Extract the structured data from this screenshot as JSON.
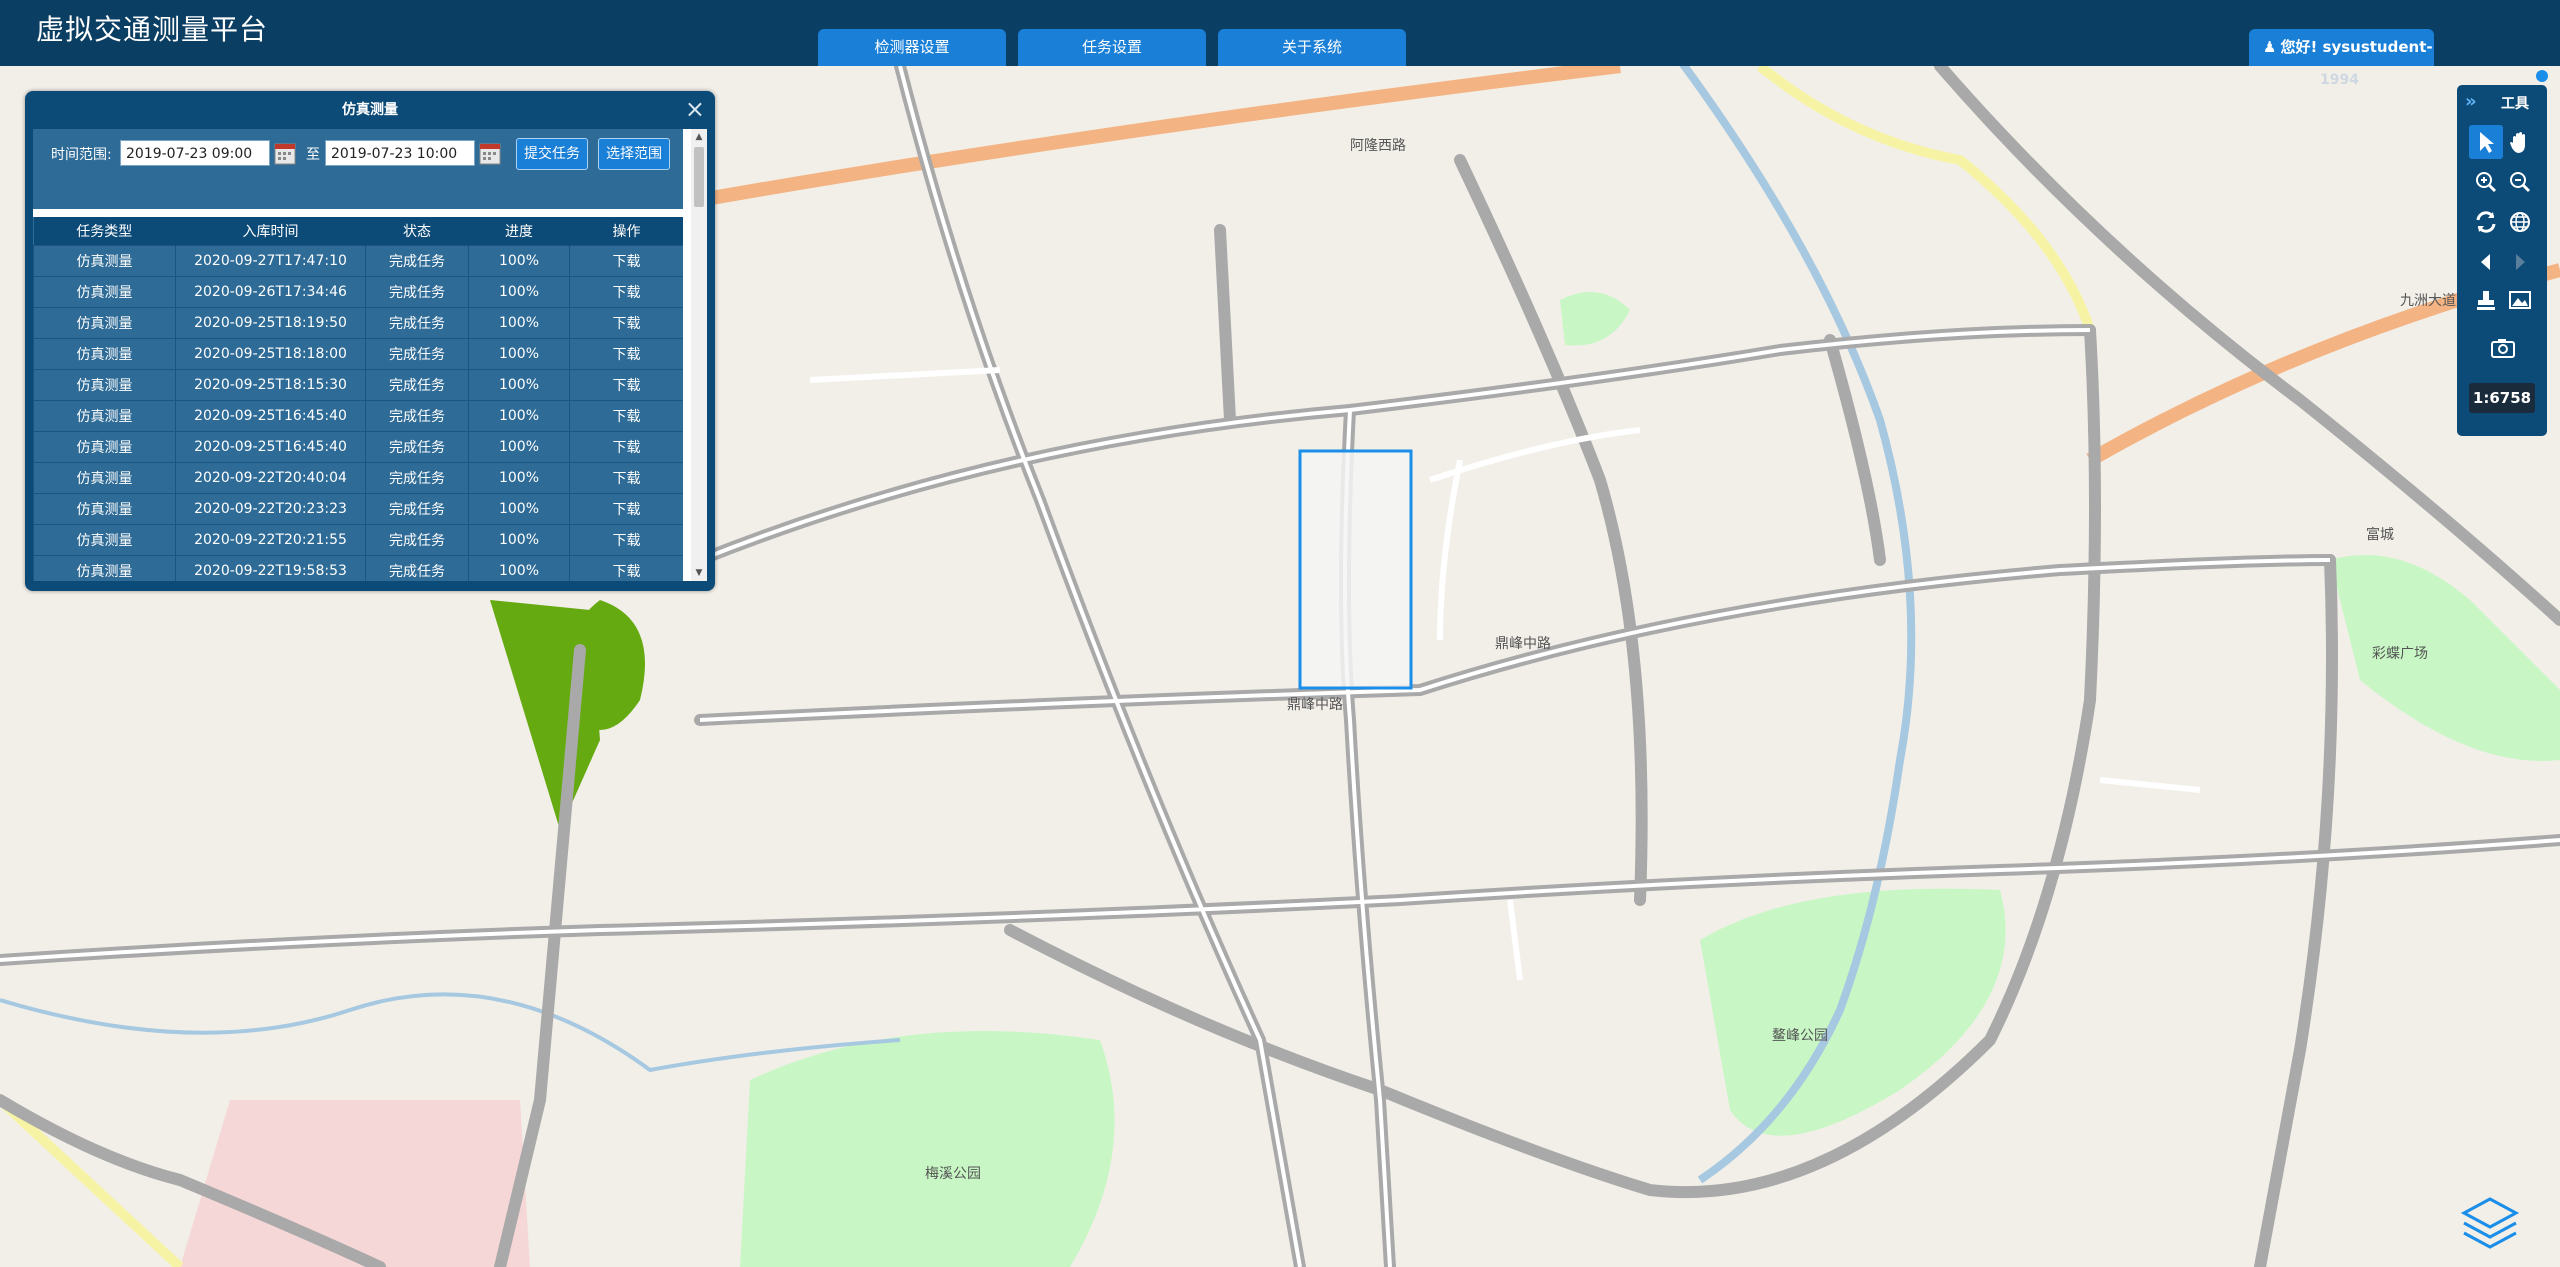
{
  "app": {
    "title": "虚拟交通测量平台"
  },
  "nav": [
    {
      "label": "检测器设置"
    },
    {
      "label": "任务设置"
    },
    {
      "label": "关于系统"
    }
  ],
  "user": {
    "greeting": "您好! sysustudent-",
    "overflow": "1994"
  },
  "panel": {
    "title": "仿真测量",
    "close": "×",
    "time_range_label": "时间范围:",
    "start_time": "2019-07-23 09:00",
    "to_label": "至",
    "end_time": "2019-07-23 10:00",
    "submit_label": "提交任务",
    "select_range_label": "选择范围",
    "table": {
      "headers": [
        "任务类型",
        "入库时间",
        "状态",
        "进度",
        "操作"
      ],
      "rows": [
        [
          "仿真测量",
          "2020-09-27T17:47:10",
          "完成任务",
          "100%",
          "下载"
        ],
        [
          "仿真测量",
          "2020-09-26T17:34:46",
          "完成任务",
          "100%",
          "下载"
        ],
        [
          "仿真测量",
          "2020-09-25T18:19:50",
          "完成任务",
          "100%",
          "下载"
        ],
        [
          "仿真测量",
          "2020-09-25T18:18:00",
          "完成任务",
          "100%",
          "下载"
        ],
        [
          "仿真测量",
          "2020-09-25T18:15:30",
          "完成任务",
          "100%",
          "下载"
        ],
        [
          "仿真测量",
          "2020-09-25T16:45:40",
          "完成任务",
          "100%",
          "下载"
        ],
        [
          "仿真测量",
          "2020-09-25T16:45:40",
          "完成任务",
          "100%",
          "下载"
        ],
        [
          "仿真测量",
          "2020-09-22T20:40:04",
          "完成任务",
          "100%",
          "下载"
        ],
        [
          "仿真测量",
          "2020-09-22T20:23:23",
          "完成任务",
          "100%",
          "下载"
        ],
        [
          "仿真测量",
          "2020-09-22T20:21:55",
          "完成任务",
          "100%",
          "下载"
        ],
        [
          "仿真测量",
          "2020-09-22T19:58:53",
          "完成任务",
          "100%",
          "下载"
        ]
      ]
    }
  },
  "tools": {
    "title": "工具",
    "scale": "1:6758",
    "icons": [
      "select-arrow-icon",
      "pan-hand-icon",
      "zoom-in-icon",
      "zoom-out-icon",
      "refresh-icon",
      "globe-icon",
      "previous-view-icon",
      "next-view-icon",
      "stamp-icon",
      "picture-icon",
      "camera-icon"
    ]
  },
  "map": {
    "labels": {
      "road_1": "阿隆西路",
      "road_2": "九洲大道",
      "park_1": "梅溪公园",
      "park_2": "鳌峰公园",
      "plaza": "彩蝶广场",
      "area_1": "富城",
      "road_3": "鼎峰中路",
      "road_4": "鼎峰中路"
    }
  },
  "colors": {
    "topbar": "#0b3e63",
    "accent": "#1a7fd6",
    "panel": "#0c4a78",
    "row": "#2e6b97",
    "map_bg": "#f2efe9",
    "park": "#c8f7c5",
    "highlight": "#1a8ee8"
  }
}
